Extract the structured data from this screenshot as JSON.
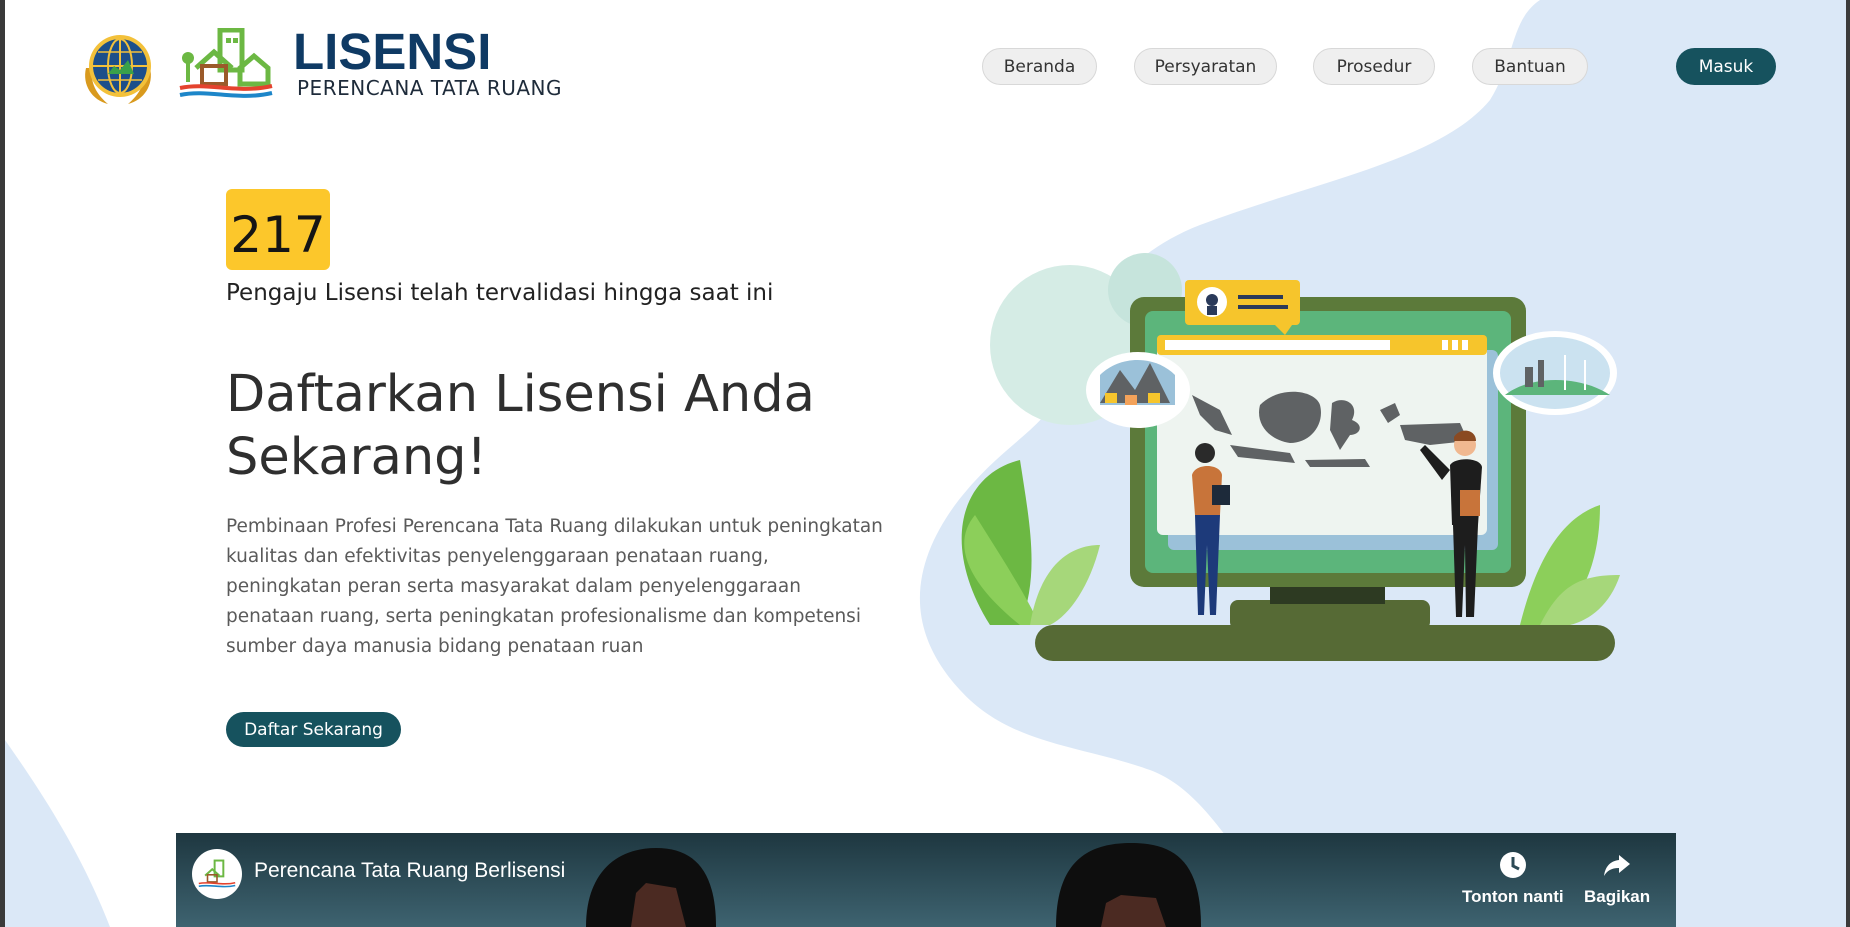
{
  "header": {
    "brand_title": "LISENSI",
    "brand_subtitle": "PERENCANA TATA RUANG",
    "emblem_icon": "ministry-emblem-icon",
    "house_icon": "house-village-logo-icon"
  },
  "nav": {
    "items": [
      {
        "label": "Beranda"
      },
      {
        "label": "Persyaratan"
      },
      {
        "label": "Prosedur"
      },
      {
        "label": "Bantuan"
      }
    ],
    "login_label": "Masuk"
  },
  "hero": {
    "counter_value": "217",
    "counter_caption": "Pengaju Lisensi telah tervalidasi hingga saat ini",
    "heading": "Daftarkan Lisensi Anda Sekarang!",
    "body": "Pembinaan Profesi Perencana Tata Ruang dilakukan untuk peningkatan kualitas dan efektivitas penyelenggaraan penataan ruang, peningkatan peran serta masyarakat dalam penyelenggaraan penataan ruang, serta peningkatan profesionalisme dan kompetensi sumber daya manusia bidang penataan ruan",
    "cta_label": "Daftar Sekarang",
    "illustration_icon": "map-presentation-illustration"
  },
  "video": {
    "title": "Perencana Tata Ruang Berlisensi",
    "watch_later_label": "Tonton nanti",
    "share_label": "Bagikan",
    "watch_later_icon": "clock-icon",
    "share_icon": "share-arrow-icon"
  },
  "colors": {
    "brand_navy": "#0f3a64",
    "primary_button": "#16525e",
    "counter_yellow": "#fcc72b",
    "blob_blue": "#dbe8f7",
    "nav_pill": "#efefef"
  }
}
